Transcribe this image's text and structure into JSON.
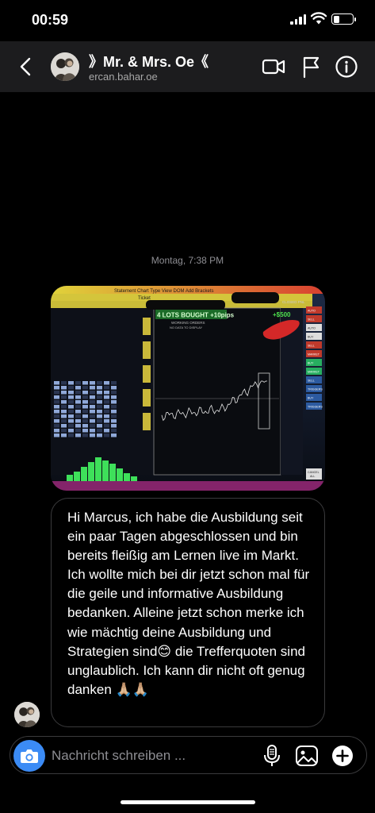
{
  "status_bar": {
    "time": "00:59",
    "battery_level": 0.3
  },
  "header": {
    "title": "》Mr. & Mrs. Oe《",
    "username": "ercan.bahar.oe",
    "icons": [
      "back-chevron-icon",
      "video-camera-icon",
      "flag-icon",
      "info-icon"
    ]
  },
  "chat": {
    "timestamp": "Montag, 7:38 PM",
    "photo": {
      "top_text": "Statement   Chart Type   View DOM   Add Brackets",
      "lots_banner": "4 LOTS BOUGHT +10pips",
      "working_orders": "WORKING ORDERS",
      "no_data": "NO DATA TO DISPLAY",
      "profit": "+$500",
      "ticket": "Ticket",
      "closed_pnl": "CLOSED PNL",
      "sidebar_buttons": [
        "AUTO",
        "SELL",
        "AUTO",
        "BUY",
        "SELL",
        "MARKET",
        "BUY",
        "MARKET",
        "SELL",
        "TRIGGERS",
        "BUY",
        "TRIGGERS",
        "CANCEL",
        "ALL"
      ]
    },
    "message": "Hi Marcus, ich habe die Ausbildung seit ein paar Tagen abgeschlossen und bin bereits fleißig am Lernen live im Markt. Ich wollte mich bei dir jetzt schon mal für die geile und informative Ausbildung bedanken. Alleine jetzt schon merke ich wie mächtig deine Ausbildung und Strategien sind😊  die Trefferquoten sind unglaublich. Ich kann dir nicht oft genug danken 🙏🏼🙏🏼"
  },
  "composer": {
    "placeholder": "Nachricht schreiben ...",
    "icons": [
      "camera-icon",
      "microphone-icon",
      "gallery-icon",
      "add-icon"
    ]
  }
}
